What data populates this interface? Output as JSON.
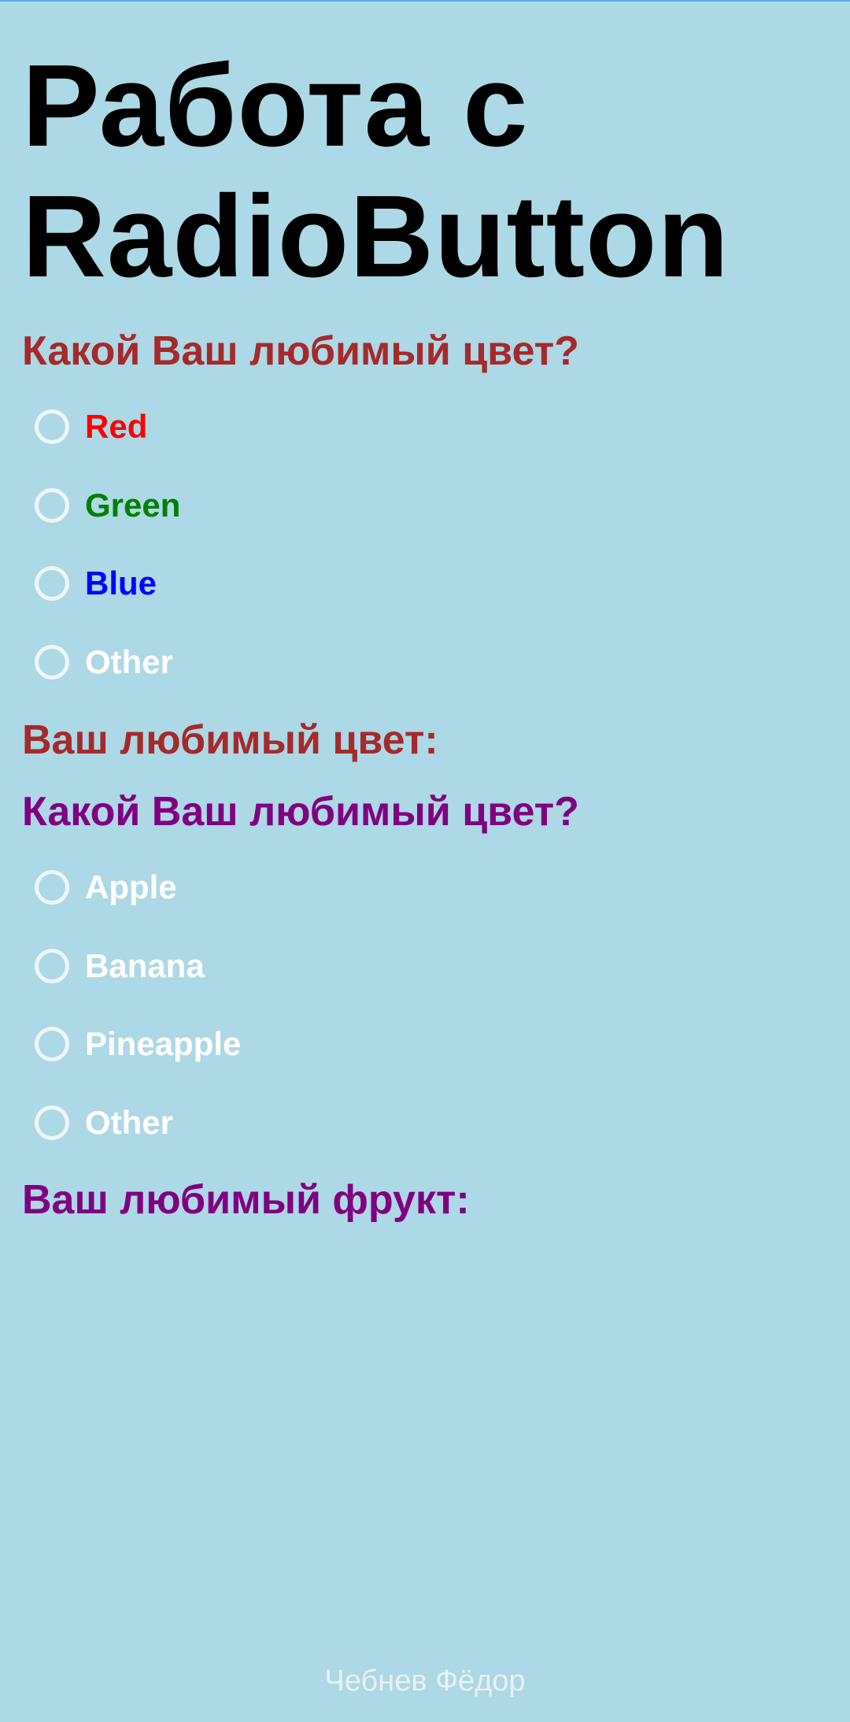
{
  "page": {
    "title": "Работа с RadioButton"
  },
  "colors": {
    "background": "#add8e6",
    "title": "#000000",
    "heading_color_section": "#a52a2a",
    "heading_fruit_section": "#800080",
    "radio_ring": "#eef5f8",
    "label_default": "#ffffff",
    "footer": "#e8f1f5"
  },
  "color_section": {
    "question": "Какой Ваш любимый цвет?",
    "options": [
      {
        "label": "Red",
        "color": "#ff0000",
        "checked": false
      },
      {
        "label": "Green",
        "color": "#008000",
        "checked": false
      },
      {
        "label": "Blue",
        "color": "#0000ff",
        "checked": false
      },
      {
        "label": "Other",
        "color": "#ffffff",
        "checked": false
      }
    ],
    "result_label": "Ваш любимый цвет:"
  },
  "fruit_section": {
    "question": "Какой Ваш любимый цвет?",
    "options": [
      {
        "label": "Apple",
        "color": "#ffffff",
        "checked": false
      },
      {
        "label": "Banana",
        "color": "#ffffff",
        "checked": false
      },
      {
        "label": "Pineapple",
        "color": "#ffffff",
        "checked": false
      },
      {
        "label": "Other",
        "color": "#ffffff",
        "checked": false
      }
    ],
    "result_label": "Ваш любимый фрукт:"
  },
  "footer": {
    "author": "Чебнев Фёдор"
  }
}
